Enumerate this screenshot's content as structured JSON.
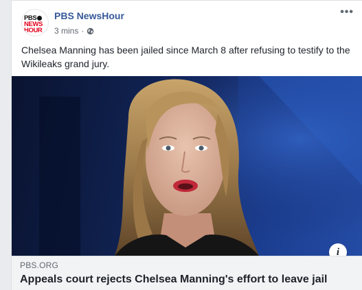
{
  "post": {
    "page_name": "PBS NewsHour",
    "logo": {
      "line1": "PBS",
      "line2": "NEWS",
      "line3": "HOUR"
    },
    "timestamp": "3 mins",
    "separator": "·",
    "privacy_icon": "globe-icon",
    "more_icon": "more-options-icon",
    "text": "Chelsea Manning has been jailed since March 8 after refusing to testify to the Wikileaks grand jury.",
    "link": {
      "domain": "PBS.ORG",
      "title": "Appeals court rejects Chelsea Manning's effort to leave jail",
      "info_icon_label": "i"
    }
  },
  "colors": {
    "page_name": "#365899",
    "meta": "#616770",
    "text": "#1d2129",
    "background": "#e9ebee",
    "link_bg": "#f2f3f5",
    "brand_red": "#e3001b"
  }
}
